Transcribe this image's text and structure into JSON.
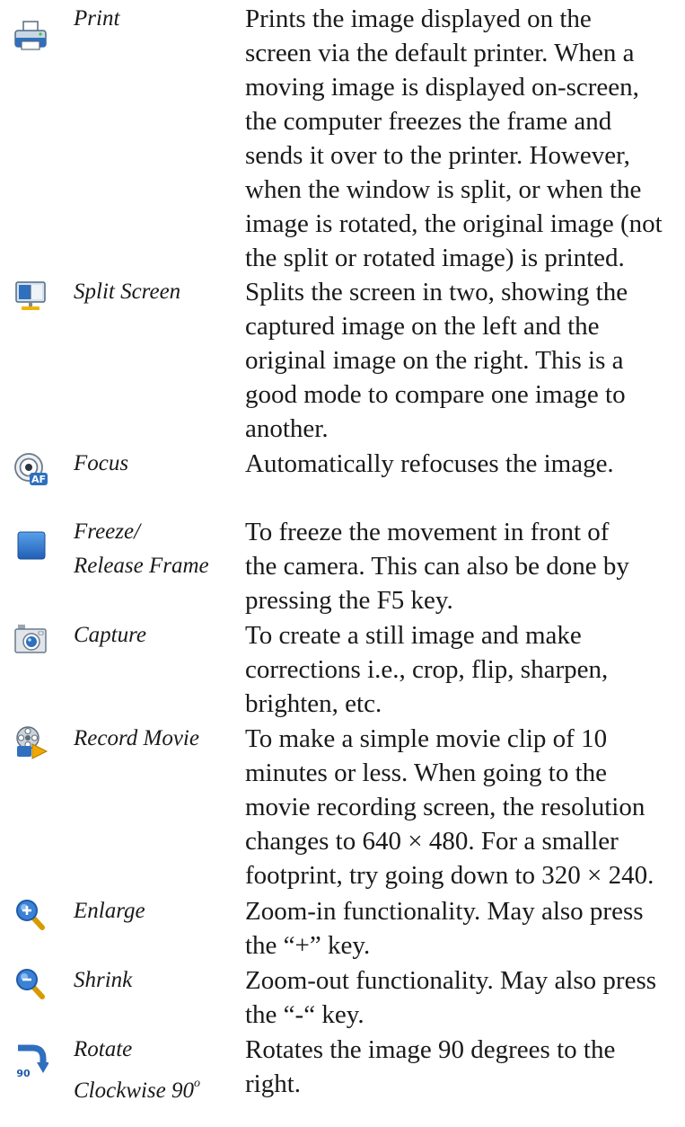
{
  "items": [
    {
      "icon": "printer-icon",
      "name_lines": [
        "Print"
      ],
      "description": "Prints the image displayed on the\nscreen via the default printer. When a\nmoving image is displayed on-screen,\nthe computer freezes the frame and\nsends it over to the printer. However,\nwhen the window is split, or when the\nimage is rotated, the original image (not\nthe split or rotated image) is printed."
    },
    {
      "icon": "split-screen-icon",
      "name_lines": [
        "Split Screen"
      ],
      "description": "Splits the screen in two, showing the\ncaptured image on the left and the\noriginal image on the right. This is a\ngood mode to compare one image to\nanother."
    },
    {
      "icon": "autofocus-icon",
      "name_lines": [
        "Focus"
      ],
      "description": "Automatically refocuses the image."
    },
    {
      "icon": "freeze-frame-icon",
      "name_lines": [
        "Freeze/",
        "Release Frame"
      ],
      "description": "To freeze the movement in front of\nthe camera. This can also be done by\npressing the F5 key."
    },
    {
      "icon": "camera-icon",
      "name_lines": [
        "Capture"
      ],
      "description": "To create a still image and make\ncorrections i.e., crop, flip, sharpen,\nbrighten, etc."
    },
    {
      "icon": "record-movie-icon",
      "name_lines": [
        "Record Movie"
      ],
      "description": "To make a simple movie clip of 10\nminutes or less. When going to the\nmovie recording screen, the resolution\nchanges to 640 × 480.  For a smaller\nfootprint, try going down to 320 × 240."
    },
    {
      "icon": "zoom-in-icon",
      "name_lines": [
        "Enlarge"
      ],
      "description": "Zoom-in functionality. May also press\nthe “+” key."
    },
    {
      "icon": "zoom-out-icon",
      "name_lines": [
        "Shrink"
      ],
      "description": "Zoom-out functionality.  May also press\nthe “-“ key."
    },
    {
      "icon": "rotate-clockwise-90-icon",
      "icon_text": "90",
      "name_lines": [
        "Rotate",
        "Clockwise 90"
      ],
      "name_superscript": "o",
      "description": "Rotates the image 90 degrees to the\nright."
    }
  ]
}
